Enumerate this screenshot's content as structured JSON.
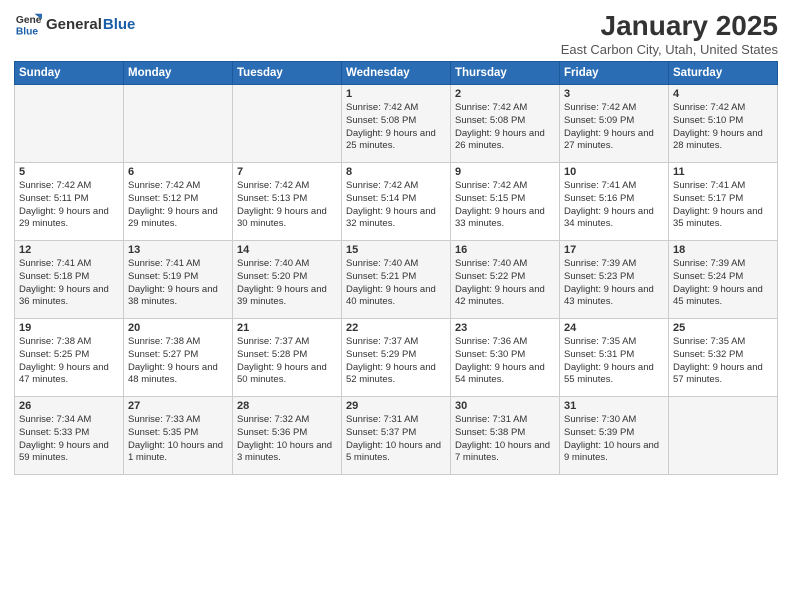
{
  "logo": {
    "general": "General",
    "blue": "Blue"
  },
  "title": "January 2025",
  "subtitle": "East Carbon City, Utah, United States",
  "days_of_week": [
    "Sunday",
    "Monday",
    "Tuesday",
    "Wednesday",
    "Thursday",
    "Friday",
    "Saturday"
  ],
  "weeks": [
    [
      {
        "day": "",
        "content": ""
      },
      {
        "day": "",
        "content": ""
      },
      {
        "day": "",
        "content": ""
      },
      {
        "day": "1",
        "content": "Sunrise: 7:42 AM\nSunset: 5:08 PM\nDaylight: 9 hours and 25 minutes."
      },
      {
        "day": "2",
        "content": "Sunrise: 7:42 AM\nSunset: 5:08 PM\nDaylight: 9 hours and 26 minutes."
      },
      {
        "day": "3",
        "content": "Sunrise: 7:42 AM\nSunset: 5:09 PM\nDaylight: 9 hours and 27 minutes."
      },
      {
        "day": "4",
        "content": "Sunrise: 7:42 AM\nSunset: 5:10 PM\nDaylight: 9 hours and 28 minutes."
      }
    ],
    [
      {
        "day": "5",
        "content": "Sunrise: 7:42 AM\nSunset: 5:11 PM\nDaylight: 9 hours and 29 minutes."
      },
      {
        "day": "6",
        "content": "Sunrise: 7:42 AM\nSunset: 5:12 PM\nDaylight: 9 hours and 29 minutes."
      },
      {
        "day": "7",
        "content": "Sunrise: 7:42 AM\nSunset: 5:13 PM\nDaylight: 9 hours and 30 minutes."
      },
      {
        "day": "8",
        "content": "Sunrise: 7:42 AM\nSunset: 5:14 PM\nDaylight: 9 hours and 32 minutes."
      },
      {
        "day": "9",
        "content": "Sunrise: 7:42 AM\nSunset: 5:15 PM\nDaylight: 9 hours and 33 minutes."
      },
      {
        "day": "10",
        "content": "Sunrise: 7:41 AM\nSunset: 5:16 PM\nDaylight: 9 hours and 34 minutes."
      },
      {
        "day": "11",
        "content": "Sunrise: 7:41 AM\nSunset: 5:17 PM\nDaylight: 9 hours and 35 minutes."
      }
    ],
    [
      {
        "day": "12",
        "content": "Sunrise: 7:41 AM\nSunset: 5:18 PM\nDaylight: 9 hours and 36 minutes."
      },
      {
        "day": "13",
        "content": "Sunrise: 7:41 AM\nSunset: 5:19 PM\nDaylight: 9 hours and 38 minutes."
      },
      {
        "day": "14",
        "content": "Sunrise: 7:40 AM\nSunset: 5:20 PM\nDaylight: 9 hours and 39 minutes."
      },
      {
        "day": "15",
        "content": "Sunrise: 7:40 AM\nSunset: 5:21 PM\nDaylight: 9 hours and 40 minutes."
      },
      {
        "day": "16",
        "content": "Sunrise: 7:40 AM\nSunset: 5:22 PM\nDaylight: 9 hours and 42 minutes."
      },
      {
        "day": "17",
        "content": "Sunrise: 7:39 AM\nSunset: 5:23 PM\nDaylight: 9 hours and 43 minutes."
      },
      {
        "day": "18",
        "content": "Sunrise: 7:39 AM\nSunset: 5:24 PM\nDaylight: 9 hours and 45 minutes."
      }
    ],
    [
      {
        "day": "19",
        "content": "Sunrise: 7:38 AM\nSunset: 5:25 PM\nDaylight: 9 hours and 47 minutes."
      },
      {
        "day": "20",
        "content": "Sunrise: 7:38 AM\nSunset: 5:27 PM\nDaylight: 9 hours and 48 minutes."
      },
      {
        "day": "21",
        "content": "Sunrise: 7:37 AM\nSunset: 5:28 PM\nDaylight: 9 hours and 50 minutes."
      },
      {
        "day": "22",
        "content": "Sunrise: 7:37 AM\nSunset: 5:29 PM\nDaylight: 9 hours and 52 minutes."
      },
      {
        "day": "23",
        "content": "Sunrise: 7:36 AM\nSunset: 5:30 PM\nDaylight: 9 hours and 54 minutes."
      },
      {
        "day": "24",
        "content": "Sunrise: 7:35 AM\nSunset: 5:31 PM\nDaylight: 9 hours and 55 minutes."
      },
      {
        "day": "25",
        "content": "Sunrise: 7:35 AM\nSunset: 5:32 PM\nDaylight: 9 hours and 57 minutes."
      }
    ],
    [
      {
        "day": "26",
        "content": "Sunrise: 7:34 AM\nSunset: 5:33 PM\nDaylight: 9 hours and 59 minutes."
      },
      {
        "day": "27",
        "content": "Sunrise: 7:33 AM\nSunset: 5:35 PM\nDaylight: 10 hours and 1 minute."
      },
      {
        "day": "28",
        "content": "Sunrise: 7:32 AM\nSunset: 5:36 PM\nDaylight: 10 hours and 3 minutes."
      },
      {
        "day": "29",
        "content": "Sunrise: 7:31 AM\nSunset: 5:37 PM\nDaylight: 10 hours and 5 minutes."
      },
      {
        "day": "30",
        "content": "Sunrise: 7:31 AM\nSunset: 5:38 PM\nDaylight: 10 hours and 7 minutes."
      },
      {
        "day": "31",
        "content": "Sunrise: 7:30 AM\nSunset: 5:39 PM\nDaylight: 10 hours and 9 minutes."
      },
      {
        "day": "",
        "content": ""
      }
    ]
  ]
}
